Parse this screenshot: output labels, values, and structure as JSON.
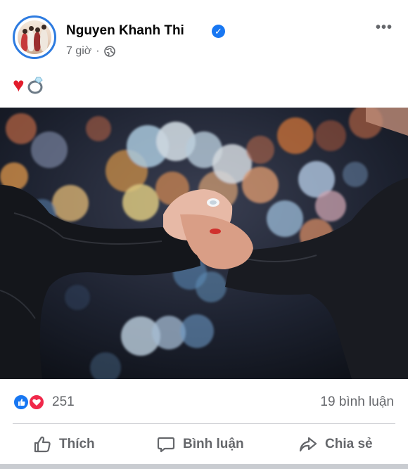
{
  "post": {
    "author": "Nguyen Khanh Thi",
    "verified": true,
    "time": "7 giờ",
    "separator": "·",
    "audience_icon": "globe-icon",
    "more_icon": "more-horizontal-icon",
    "more_label": "•••",
    "content_emojis": [
      "heart-icon",
      "ring-icon"
    ],
    "heart": "♥"
  },
  "stats": {
    "reaction_icons": [
      "like-reaction-icon",
      "love-reaction-icon"
    ],
    "reaction_count": "251",
    "comment_count": "19 bình luận"
  },
  "actions": {
    "like_label": "Thích",
    "comment_label": "Bình luận",
    "share_label": "Chia sẻ"
  },
  "colors": {
    "brand_blue": "#1877f2",
    "love_red": "#f0284a",
    "meta_gray": "#65676b",
    "divider": "#ced0d4"
  }
}
